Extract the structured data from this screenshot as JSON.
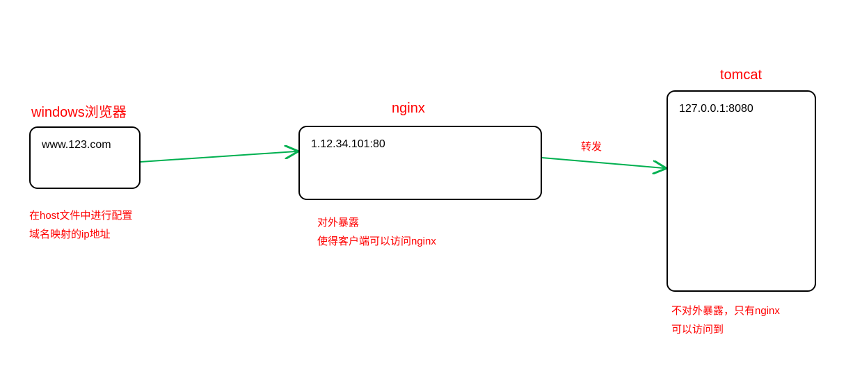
{
  "nodes": {
    "browser": {
      "title": "windows浏览器",
      "content": "www.123.com",
      "annotation_line1": "在host文件中进行配置",
      "annotation_line2": "域名映射的ip地址"
    },
    "nginx": {
      "title": "nginx",
      "content": "1.12.34.101:80",
      "annotation_line1": "对外暴露",
      "annotation_line2": "使得客户端可以访问nginx"
    },
    "tomcat": {
      "title": "tomcat",
      "content": "127.0.0.1:8080",
      "annotation_line1": "不对外暴露，只有nginx",
      "annotation_line2": "可以访问到"
    }
  },
  "arrows": {
    "forward_label": "转发"
  },
  "chart_data": {
    "type": "diagram",
    "title": "Nginx Reverse Proxy Architecture",
    "nodes": [
      {
        "id": "browser",
        "label": "windows浏览器",
        "value": "www.123.com",
        "note": "在host文件中进行配置 域名映射的ip地址"
      },
      {
        "id": "nginx",
        "label": "nginx",
        "value": "1.12.34.101:80",
        "note": "对外暴露 使得客户端可以访问nginx"
      },
      {
        "id": "tomcat",
        "label": "tomcat",
        "value": "127.0.0.1:8080",
        "note": "不对外暴露，只有nginx 可以访问到"
      }
    ],
    "edges": [
      {
        "from": "browser",
        "to": "nginx",
        "label": ""
      },
      {
        "from": "nginx",
        "to": "tomcat",
        "label": "转发"
      }
    ]
  }
}
